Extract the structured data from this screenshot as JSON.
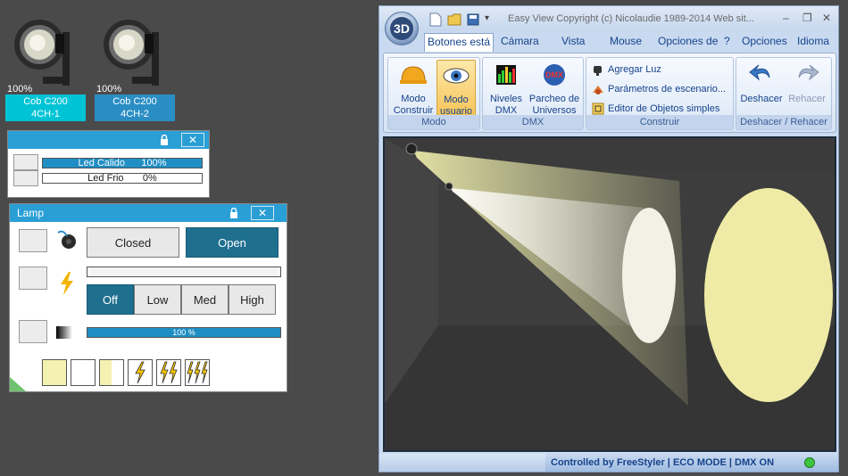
{
  "fixtures": [
    {
      "percent": "100%",
      "name": "Cob C200",
      "mode": "4CH-1",
      "color": "#00c4d6"
    },
    {
      "percent": "100%",
      "name": "Cob C200",
      "mode": "4CH-2",
      "color": "#2a8ec4"
    }
  ],
  "led_panel": {
    "channels": [
      {
        "label": "Led Calido",
        "value": "100%",
        "level": 1.0
      },
      {
        "label": "Led Frio",
        "value": "0%",
        "level": 0.0
      }
    ]
  },
  "lamp_panel": {
    "title": "Lamp",
    "shutter": {
      "closed_label": "Closed",
      "open_label": "Open",
      "selected": "Open"
    },
    "power": {
      "options": [
        "Off",
        "Low",
        "Med",
        "High"
      ],
      "selected": "Off"
    },
    "dimmer_label": "100 %",
    "dimmer_level": 1.0
  },
  "window": {
    "title": "Easy View   Copyright (c) Nicolaudie 1989-2014   Web sit...",
    "tabs": [
      "Botones está",
      "Cámara",
      "Vista",
      "Mouse",
      "Opciones de",
      "?",
      "Opciones",
      "Idioma"
    ],
    "ribbon": {
      "modo": {
        "label": "Modo",
        "buttons": [
          [
            "Modo",
            "Construir"
          ],
          [
            "Modo",
            "usuario"
          ]
        ]
      },
      "dmx": {
        "label": "DMX",
        "buttons": [
          [
            "Niveles",
            "DMX"
          ],
          [
            "Parcheo de",
            "Universos"
          ]
        ]
      },
      "construir": {
        "label": "Construir",
        "items": [
          "Agregar Luz",
          "Parámetros de escenario...",
          "Editor de Objetos simples"
        ]
      },
      "undo": {
        "label": "Deshacer / Rehacer",
        "buttons": [
          "Deshacer",
          "Rehacer"
        ]
      }
    },
    "status": "Controlled by FreeStyler   |   ECO MODE   |   DMX ON",
    "status_color": "#3cc43c"
  }
}
